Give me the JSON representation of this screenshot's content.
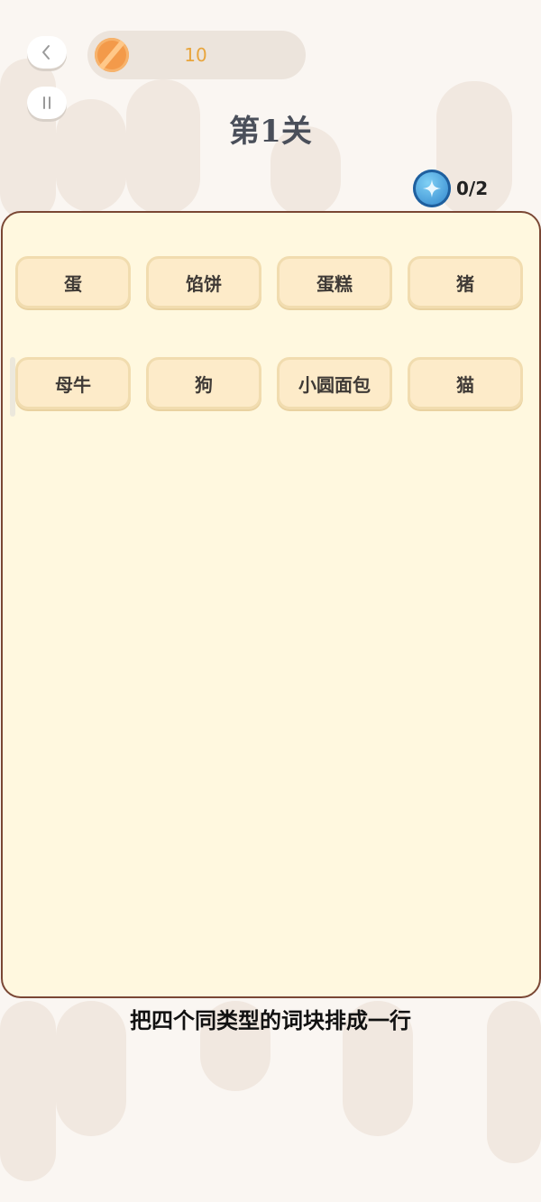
{
  "header": {
    "back_icon": "chevron-left-icon",
    "pause_icon": "pause-icon",
    "coins": "10",
    "coin_icon": "coin-icon",
    "level_title": "第1关",
    "gem_icon": "gem-icon",
    "gem_progress": "0/2"
  },
  "board": {
    "tiles": [
      "蛋",
      "馅饼",
      "蛋糕",
      "猪",
      "母牛",
      "狗",
      "小圆面包",
      "猫"
    ]
  },
  "footer": {
    "instruction": "把四个同类型的词块排成一行"
  },
  "colors": {
    "background": "#faf6f2",
    "board": "#fff8df",
    "board_border": "#7a4734",
    "tile": "#fdebc9",
    "coin_text": "#e8a53d"
  }
}
